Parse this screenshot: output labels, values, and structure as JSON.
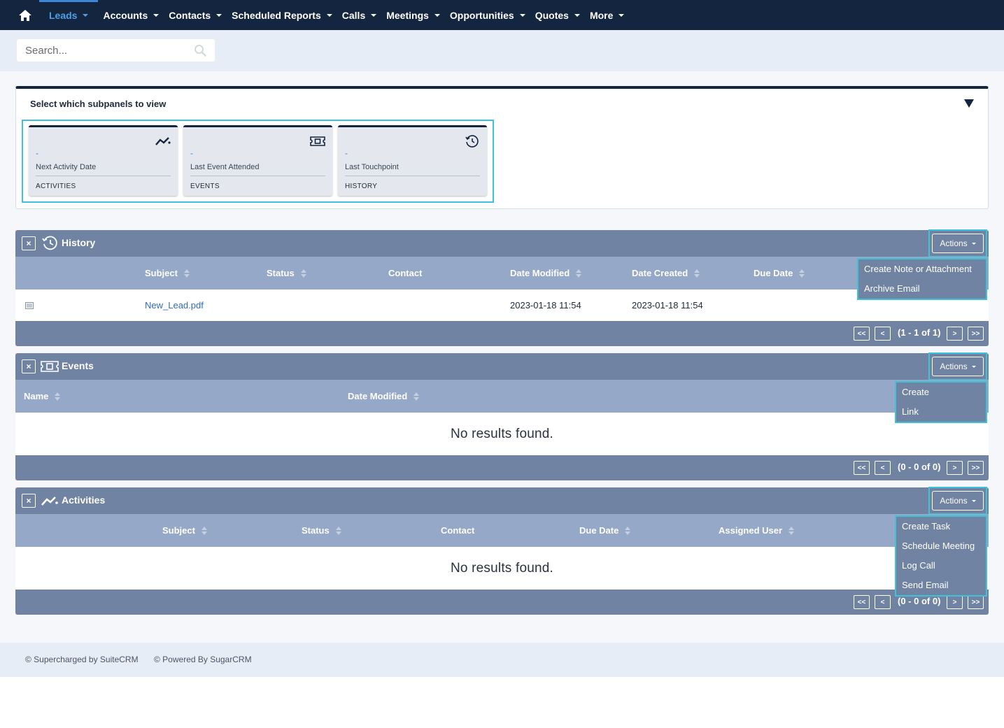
{
  "nav": {
    "home_icon": "home-icon",
    "items": [
      {
        "label": "Leads",
        "active": true
      },
      {
        "label": "Accounts"
      },
      {
        "label": "Contacts"
      },
      {
        "label": "Scheduled Reports"
      },
      {
        "label": "Calls"
      },
      {
        "label": "Meetings"
      },
      {
        "label": "Opportunities"
      },
      {
        "label": "Quotes"
      },
      {
        "label": "More"
      }
    ]
  },
  "search": {
    "placeholder": "Search...",
    "icon": "search-icon"
  },
  "selector": {
    "title": "Select which subpanels to view",
    "cards": [
      {
        "value": "-",
        "label": "Next Activity Date",
        "type": "ACTIVITIES",
        "icon": "activity-chart-icon"
      },
      {
        "value": "-",
        "label": "Last Event Attended",
        "type": "EVENTS",
        "icon": "ticket-icon"
      },
      {
        "value": "-",
        "label": "Last Touchpoint",
        "type": "HISTORY",
        "icon": "history-clock-icon"
      }
    ]
  },
  "history": {
    "title": "History",
    "close": "×",
    "actions_label": "Actions",
    "columns": [
      "Subject",
      "Status",
      "Contact",
      "Date Modified",
      "Date Created",
      "Due Date"
    ],
    "rows": [
      {
        "subject": "New_Lead.pdf",
        "date_modified": "2023-01-18 11:54",
        "date_created": "2023-01-18 11:54"
      }
    ],
    "menu": [
      "Create Note or Attachment",
      "Archive Email"
    ],
    "pagination": {
      "first": "<<",
      "prev": "<",
      "count": "(1 - 1 of 1)",
      "next": ">",
      "last": ">>"
    }
  },
  "events": {
    "title": "Events",
    "close": "×",
    "actions_label": "Actions",
    "columns": [
      "Name",
      "Date Modified"
    ],
    "empty": "No results found.",
    "menu": [
      "Create",
      "Link"
    ],
    "pagination": {
      "first": "<<",
      "prev": "<",
      "count": "(0 - 0 of 0)",
      "next": ">",
      "last": ">>"
    }
  },
  "activities": {
    "title": "Activities",
    "close": "×",
    "actions_label": "Actions",
    "columns": [
      "Subject",
      "Status",
      "Contact",
      "Due Date",
      "Assigned User"
    ],
    "empty": "No results found.",
    "menu": [
      "Create Task",
      "Schedule Meeting",
      "Log Call",
      "Send Email"
    ],
    "pagination": {
      "first": "<<",
      "prev": "<",
      "count": "(0 - 0 of 0)",
      "next": ">",
      "last": ">>"
    }
  },
  "footer": {
    "left": "© Supercharged by SuiteCRM",
    "right": "© Powered By SugarCRM"
  },
  "colors": {
    "nav_bg": "#14253f",
    "panel_head": "#7183a3",
    "panel_cols": "#95a8c7",
    "highlight": "#3fc2d6",
    "link": "#2e6bbf"
  }
}
